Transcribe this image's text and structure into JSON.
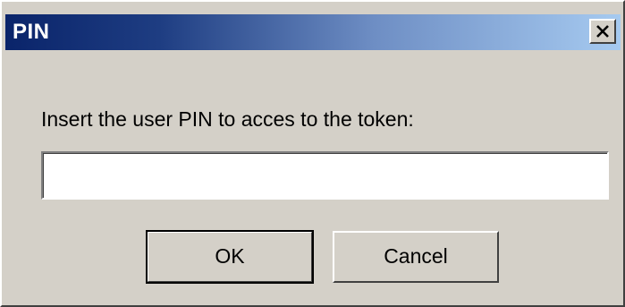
{
  "window": {
    "title": "PIN",
    "close_label": "×"
  },
  "dialog": {
    "prompt": "Insert the user PIN to acces to the token:",
    "pin_value": "",
    "ok_label": "OK",
    "cancel_label": "Cancel"
  },
  "colors": {
    "face": "#d4d0c8",
    "title_start": "#0a246a",
    "title_end": "#a6caf0"
  },
  "icons": {
    "close": "close-icon"
  }
}
